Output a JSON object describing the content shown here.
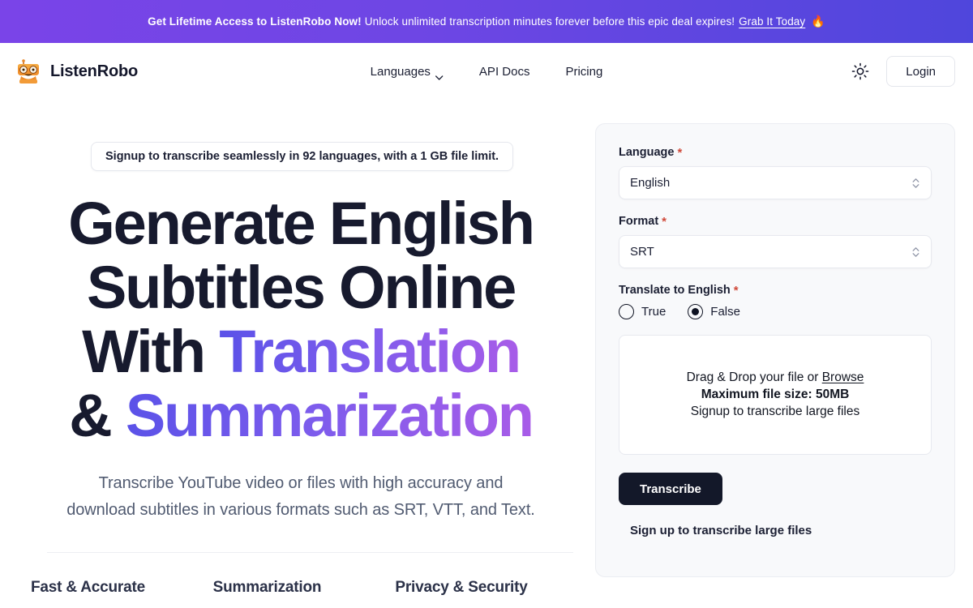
{
  "promo_banner": {
    "headline": "Get Lifetime Access to ListenRobo Now!",
    "message": "Unlock unlimited transcription minutes forever before this epic deal expires!",
    "cta_label": "Grab It Today",
    "emoji": "🔥",
    "gradient_from": "#7A44E8",
    "gradient_to": "#4F46DC"
  },
  "header": {
    "brand_name": "ListenRobo",
    "logo_icon": "robot-icon",
    "nav": [
      {
        "label": "Languages",
        "icon": "chevron-down-icon",
        "has_dropdown": true
      },
      {
        "label": "API Docs",
        "has_dropdown": false
      },
      {
        "label": "Pricing",
        "has_dropdown": false
      }
    ],
    "theme_toggle_icon": "sun-icon",
    "login_label": "Login"
  },
  "hero": {
    "badge": "Signup to transcribe seamlessly in 92 languages, with a 1 GB file limit.",
    "title_line1": "Generate English",
    "title_line2": "Subtitles Online",
    "title_line3_plain": "With ",
    "title_line3_accent": "Translation",
    "title_line4_plain": "& ",
    "title_line4_accent": "Summarization",
    "subtitle_line1": "Transcribe YouTube video or files with high accuracy and",
    "subtitle_line2": "download subtitles in various formats such as SRT, VTT, and Text.",
    "accent_gradient_from": "#5B52E8",
    "accent_gradient_to": "#A85CE8",
    "title_color": "#171A2E"
  },
  "features": [
    {
      "title": "Fast & Accurate"
    },
    {
      "title": "Summarization"
    },
    {
      "title": "Privacy & Security"
    }
  ],
  "form": {
    "language": {
      "label": "Language",
      "required_marker": "*",
      "value": "English",
      "caret_icon": "chevron-up-down-icon"
    },
    "format": {
      "label": "Format",
      "required_marker": "*",
      "value": "SRT",
      "caret_icon": "chevron-up-down-icon"
    },
    "translate": {
      "label": "Translate to English",
      "required_marker": "*",
      "options": [
        {
          "label": "True",
          "selected": false
        },
        {
          "label": "False",
          "selected": true
        }
      ]
    },
    "dropzone": {
      "prompt_prefix": "Drag & Drop your file or ",
      "browse_label": "Browse",
      "max_size": "Maximum file size: 50MB",
      "signup_hint": "Signup to transcribe large files"
    },
    "submit_label": "Transcribe",
    "signup_note": "Sign up to transcribe large files"
  }
}
